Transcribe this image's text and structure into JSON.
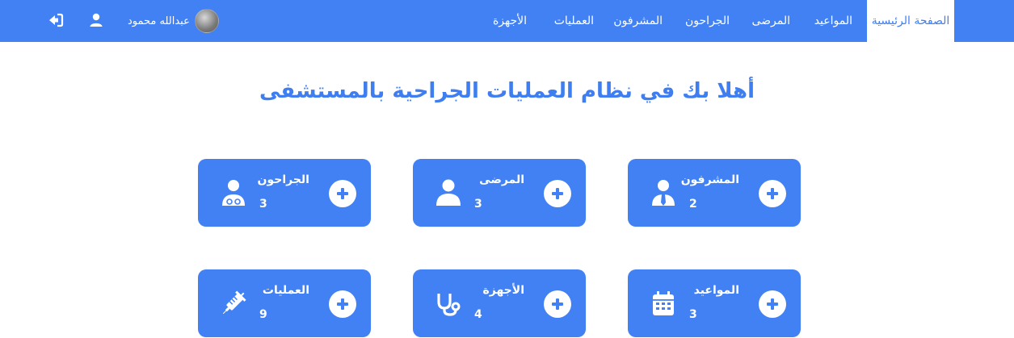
{
  "navbar": {
    "items": [
      {
        "label": "الصفحة الرئيسية",
        "active": true
      },
      {
        "label": "المواعيد"
      },
      {
        "label": "المرضى"
      },
      {
        "label": "الجراحون"
      },
      {
        "label": "المشرفون"
      },
      {
        "label": "العمليات"
      },
      {
        "label": "الأجهزة"
      }
    ],
    "user_name": "عبدالله محمود"
  },
  "page_title": "أهلا بك في نظام العمليات الجراحية بالمستشفى",
  "cards": [
    {
      "label": "المشرفون",
      "count": "2",
      "icon": "user-tie-icon"
    },
    {
      "label": "المرضى",
      "count": "3",
      "icon": "user-icon"
    },
    {
      "label": "الجراحون",
      "count": "3",
      "icon": "user-doctor-icon"
    },
    {
      "label": "المواعيد",
      "count": "3",
      "icon": "calendar-icon"
    },
    {
      "label": "الأجهزة",
      "count": "4",
      "icon": "stethoscope-icon"
    },
    {
      "label": "العمليات",
      "count": "9",
      "icon": "syringe-icon"
    }
  ],
  "colors": {
    "primary": "#4281f4",
    "text_on_primary": "#ffffff"
  }
}
